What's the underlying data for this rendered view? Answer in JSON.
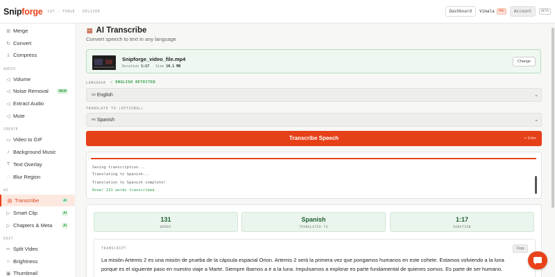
{
  "header": {
    "logo_main": "Snip",
    "logo_accent": "forge",
    "tagline": "CUT · FORGE · DELIVER",
    "dashboard_label": "Dashboard",
    "user_name": "Vimala",
    "user_badge": "PRO",
    "account_label": "Account",
    "beta_label": "BETA"
  },
  "sidebar": {
    "items_top": [
      {
        "icon": "⊞",
        "icon_name": "merge-icon",
        "label": "Merge"
      },
      {
        "icon": "↻",
        "icon_name": "convert-icon",
        "label": "Convert"
      },
      {
        "icon": "⤓",
        "icon_name": "compress-icon",
        "label": "Compress"
      }
    ],
    "section_audio": "AUDIO",
    "items_audio": [
      {
        "icon": "◁",
        "icon_name": "volume-icon",
        "label": "Volume"
      },
      {
        "icon": "◁",
        "icon_name": "noise-removal-icon",
        "label": "Noise Removal",
        "badge": "NEW"
      },
      {
        "icon": "◁",
        "icon_name": "extract-audio-icon",
        "label": "Extract Audio"
      },
      {
        "icon": "◁",
        "icon_name": "mute-icon",
        "label": "Mute"
      }
    ],
    "section_create": "CREATE",
    "items_create": [
      {
        "icon": "▭",
        "icon_name": "video-to-gif-icon",
        "label": "Video to GIF"
      },
      {
        "icon": "♪",
        "icon_name": "music-icon",
        "label": "Background Music"
      },
      {
        "icon": "T",
        "icon_name": "text-overlay-icon",
        "label": "Text Overlay"
      },
      {
        "icon": "◌",
        "icon_name": "blur-icon",
        "label": "Blur Region"
      }
    ],
    "section_ai": "AI",
    "items_ai": [
      {
        "icon": "▤",
        "icon_name": "transcribe-icon",
        "label": "Transcribe",
        "badge": "AI",
        "active": true
      },
      {
        "icon": "▷",
        "icon_name": "smart-clip-icon",
        "label": "Smart Clip",
        "badge": "AI"
      },
      {
        "icon": "▷",
        "icon_name": "chapters-icon",
        "label": "Chapters & Meta",
        "badge": "AI"
      }
    ],
    "section_edit": "EDIT",
    "items_edit": [
      {
        "icon": "✂",
        "icon_name": "split-video-icon",
        "label": "Split Video"
      },
      {
        "icon": "☼",
        "icon_name": "brightness-icon",
        "label": "Brightness"
      },
      {
        "icon": "▣",
        "icon_name": "thumbnail-icon",
        "label": "Thumbnail"
      }
    ]
  },
  "main": {
    "title": "AI Transcribe",
    "subtitle": "Convert speech to text in any language",
    "file": {
      "name": "Snipforge_video_file.mp4",
      "duration_label": "Duration",
      "duration": "1:17",
      "size_label": "Size",
      "size": "10.1 MB",
      "change_label": "Change"
    },
    "language_label": "LANGUAGE",
    "detected_label": "✓ ENGLISH DETECTED",
    "language_flag": "us",
    "language_value": "English",
    "translate_label": "TRANSLATE TO (OPTIONAL)",
    "translate_flag": "es",
    "translate_value": "Spanish",
    "transcribe_button": "Transcribe Speech",
    "enter_hint": "↵ Enter",
    "log": [
      "Saving transcription...",
      "Translating to Spanish...",
      "Translation to Spanish complete!",
      "Done! 131 words transcribed."
    ],
    "stats": [
      {
        "value": "131",
        "label": "WORDS"
      },
      {
        "value": "Spanish",
        "label": "TRANSLATED TO"
      },
      {
        "value": "1:17",
        "label": "DURATION"
      }
    ],
    "transcript_label": "TRANSCRIPT",
    "copy_label": "Copy",
    "transcript_text": "La misión Artemis 2 es una misión de prueba de la cápsula espacial Orion. Artemis 2 será la primera vez que pongamos humanos en este cohete. Estamos volviendo a la luna porque es el siguiente paso en nuestro viaje a Marte. Siempre íbamos a ir a la luna. Impulsarnos a explorar es parte fundamental de quienes somos. Es parte de ser humano."
  },
  "colors": {
    "accent": "#e8421a",
    "success": "#2f9e44"
  }
}
